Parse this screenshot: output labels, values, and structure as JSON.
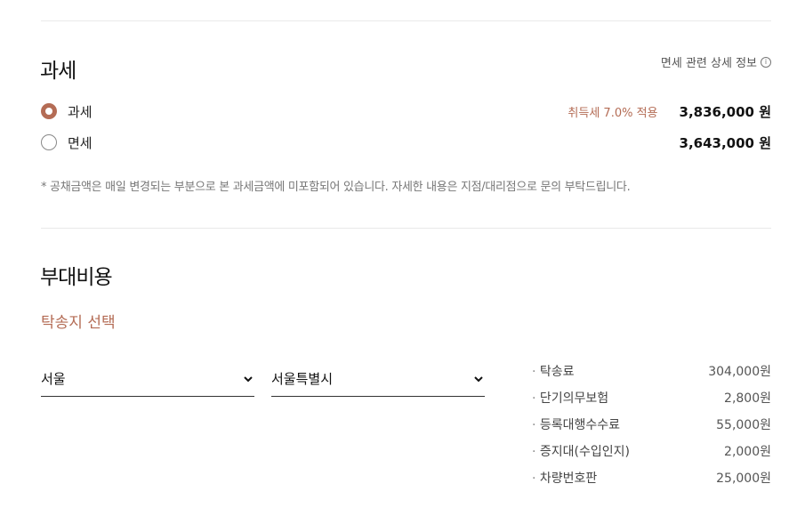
{
  "tax_section": {
    "title": "과세",
    "info_link": "면세 관련 상세 정보",
    "options": [
      {
        "label": "과세",
        "note": "취득세 7.0% 적용",
        "price": "3,836,000 원",
        "selected": true
      },
      {
        "label": "면세",
        "note": "",
        "price": "3,643,000 원",
        "selected": false
      }
    ],
    "notice": "* 공채금액은 매일 변경되는 부분으로 본 과세금액에 미포함되어 있습니다. 자세한 내용은 지점/대리점으로 문의 부탁드립니다."
  },
  "extra_costs": {
    "title": "부대비용",
    "delivery_label": "탁송지 선택",
    "region_select": {
      "value": "서울"
    },
    "city_select": {
      "value": "서울특별시"
    },
    "fees": [
      {
        "label": "탁송료",
        "amount": "304,000원"
      },
      {
        "label": "단기의무보험",
        "amount": "2,800원"
      },
      {
        "label": "등록대행수수료",
        "amount": "55,000원"
      },
      {
        "label": "증지대(수입인지)",
        "amount": "2,000원"
      },
      {
        "label": "차량번호판",
        "amount": "25,000원"
      }
    ]
  },
  "colors": {
    "accent": "#b46c55",
    "divider": "#e9e9e9"
  }
}
